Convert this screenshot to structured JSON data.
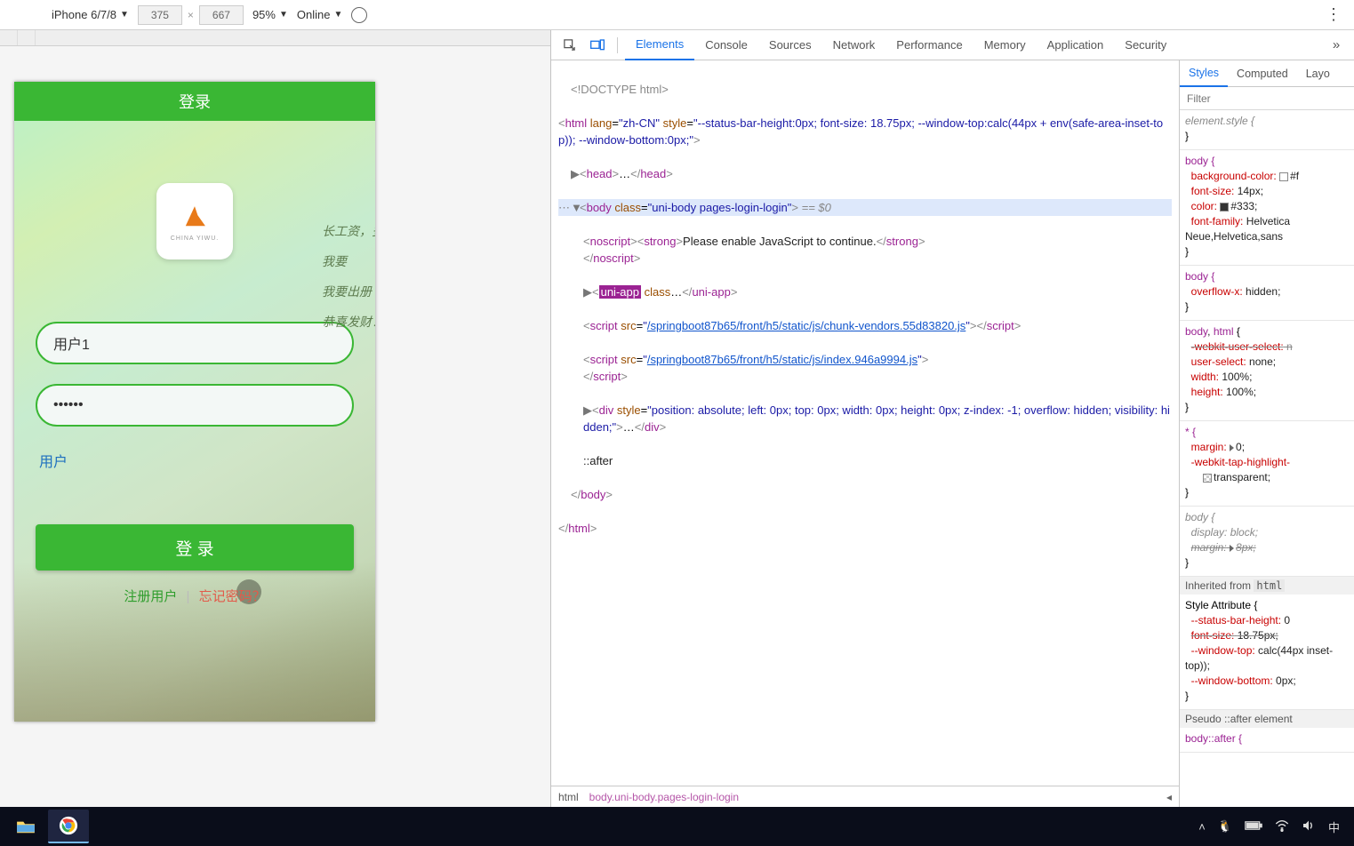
{
  "deviceBar": {
    "device": "iPhone 6/7/8",
    "width": "375",
    "height": "667",
    "zoom": "95%",
    "network": "Online"
  },
  "app": {
    "headerTitle": "登录",
    "logoText": "CHINA YIWU.",
    "quotes": [
      "长工资，多",
      "我要",
      "我要出册",
      "恭喜发财！"
    ],
    "usernameValue": "用户1",
    "passwordValue": "······",
    "roleLabel": "用户",
    "loginBtn": "登 录",
    "registerLink": "注册用户",
    "forgotLink": "忘记密码？"
  },
  "devTabs": [
    "Elements",
    "Console",
    "Sources",
    "Network",
    "Performance",
    "Memory",
    "Application",
    "Security"
  ],
  "devActiveTab": "Elements",
  "dom": {
    "doctype": "<!DOCTYPE html>",
    "htmlOpen": {
      "lang": "zh-CN",
      "style": "--status-bar-height:0px; font-size: 18.75px; --window-top:calc(44px + env(safe-area-inset-top)); --window-bottom:0px;"
    },
    "bodyClass": "uni-body pages-login-login",
    "eqDollar": "== $0",
    "noscript": "Please enable JavaScript to continue.",
    "uniAppClass": "class",
    "script1": "/springboot87b65/front/h5/static/js/chunk-vendors.55d83820.js",
    "script2": "/springboot87b65/front/h5/static/js/index.946a9994.js",
    "divStyle": "position: absolute; left: 0px; top: 0px; width: 0px; height: 0px; z-index: -1; overflow: hidden; visibility: hidden;",
    "after": "::after"
  },
  "breadcrumb": {
    "root": "html",
    "sel": "body.uni-body.pages-login-login"
  },
  "styles": {
    "tabs": [
      "Styles",
      "Computed",
      "Layo"
    ],
    "activeTab": "Styles",
    "filterPlaceholder": "Filter",
    "rules": {
      "elementStyle": "element.style {",
      "body1": {
        "sel": "body {",
        "bg": "background-color:",
        "bgv": "#f",
        "fs": "font-size:",
        "fsv": "14px;",
        "col": "color:",
        "colv": "#333;",
        "ff": "font-family:",
        "ffv": "Helvetica Neue,Helvetica,sans"
      },
      "body2": {
        "sel": "body {",
        "ox": "overflow-x:",
        "oxv": "hidden;"
      },
      "bodyHtml": {
        "sel": "body, html {",
        "wus": "-webkit-user-select:",
        "us": "user-select:",
        "usv": "none;",
        "w": "width:",
        "wv": "100%;",
        "h": "height:",
        "hv": "100%;"
      },
      "star": {
        "sel": "* {",
        "m": "margin:",
        "mv": "0;",
        "wth": "-webkit-tap-highlight-",
        "tv": "transparent;"
      },
      "bodyUA": {
        "sel": "body {",
        "d": "display:",
        "dv": "block;",
        "m": "margin:",
        "mv": "8px;"
      },
      "inheritedFrom": "Inherited from",
      "inheritedTag": "html",
      "styleAttr": {
        "sel": "Style Attribute {",
        "sbh": "--status-bar-height:",
        "sbhv": "0",
        "fs": "font-size:",
        "fsv": "18.75px;",
        "wt": "--window-top:",
        "wtv": "calc(44px inset-top));",
        "wb": "--window-bottom:",
        "wbv": "0px;"
      },
      "pseudoHdr": "Pseudo ::after element",
      "bodyAfter": "body::after {"
    }
  },
  "tray": {
    "ime": "中"
  }
}
